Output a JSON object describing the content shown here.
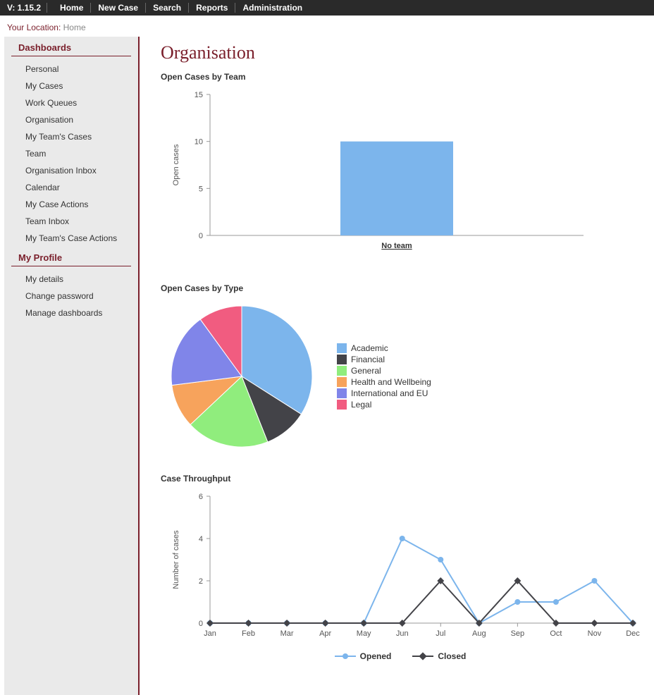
{
  "topnav": {
    "version": "V: 1.15.2",
    "items": [
      "Home",
      "New Case",
      "Search",
      "Reports",
      "Administration"
    ]
  },
  "breadcrumb": {
    "label": "Your Location:",
    "location": "Home"
  },
  "sidebar": {
    "sections": [
      {
        "title": "Dashboards",
        "items": [
          "Personal",
          "My Cases",
          "Work Queues",
          "Organisation",
          "My Team's Cases",
          "Team",
          "Organisation Inbox",
          "Calendar",
          "My Case Actions",
          "Team Inbox",
          "My Team's Case Actions"
        ]
      },
      {
        "title": "My Profile",
        "items": [
          "My details",
          "Change password",
          "Manage dashboards"
        ]
      }
    ]
  },
  "page_title": "Organisation",
  "charts": {
    "open_by_team": {
      "title": "Open Cases by Team",
      "no_team_label": "No team"
    },
    "open_by_type": {
      "title": "Open Cases by Type"
    },
    "throughput": {
      "title": "Case Throughput"
    }
  },
  "legend_labels": {
    "academic": "Academic",
    "financial": "Financial",
    "general": "General",
    "health": "Health and Wellbeing",
    "intl": "International and EU",
    "legal": "Legal",
    "opened": "Opened",
    "closed": "Closed"
  },
  "chart_data": [
    {
      "type": "bar",
      "title": "Open Cases by Team",
      "ylabel": "Open cases",
      "xlabel": "",
      "ylim": [
        0,
        15
      ],
      "yticks": [
        0,
        5,
        10,
        15
      ],
      "categories": [
        "No team"
      ],
      "values": [
        10
      ],
      "colors": {
        "bar": "#7cb5ec"
      }
    },
    {
      "type": "pie",
      "title": "Open Cases by Type",
      "series": [
        {
          "name": "Academic",
          "value": 34,
          "color": "#7cb5ec"
        },
        {
          "name": "Financial",
          "value": 10,
          "color": "#434348"
        },
        {
          "name": "General",
          "value": 19,
          "color": "#90ed7d"
        },
        {
          "name": "Health and Wellbeing",
          "value": 10,
          "color": "#f7a35c"
        },
        {
          "name": "International and EU",
          "value": 17,
          "color": "#8085e9"
        },
        {
          "name": "Legal",
          "value": 10,
          "color": "#f15c80"
        }
      ]
    },
    {
      "type": "line",
      "title": "Case Throughput",
      "ylabel": "Number of cases",
      "xlabel": "",
      "ylim": [
        0,
        6
      ],
      "yticks": [
        0,
        2,
        4,
        6
      ],
      "categories": [
        "Jan",
        "Feb",
        "Mar",
        "Apr",
        "May",
        "Jun",
        "Jul",
        "Aug",
        "Sep",
        "Oct",
        "Nov",
        "Dec"
      ],
      "series": [
        {
          "name": "Opened",
          "color": "#7cb5ec",
          "marker": "circle",
          "values": [
            0,
            0,
            0,
            0,
            0,
            4,
            3,
            0,
            1,
            1,
            2,
            0
          ]
        },
        {
          "name": "Closed",
          "color": "#434348",
          "marker": "diamond",
          "values": [
            0,
            0,
            0,
            0,
            0,
            0,
            2,
            0,
            2,
            0,
            0,
            0
          ]
        }
      ]
    }
  ]
}
